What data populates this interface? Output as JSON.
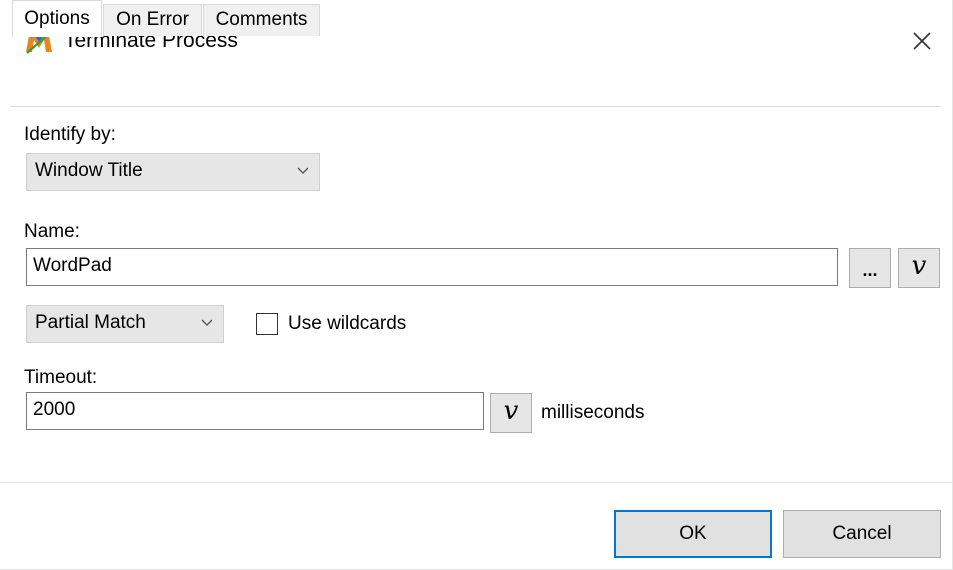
{
  "window": {
    "title": "Terminate Process",
    "app_icon": "macro-m-icon",
    "close_icon": "close-x-icon"
  },
  "tabs": [
    {
      "label": "Options",
      "active": true
    },
    {
      "label": "On Error",
      "active": false
    },
    {
      "label": "Comments",
      "active": false
    }
  ],
  "options": {
    "identify_by": {
      "label": "Identify by:",
      "selected": "Window Title"
    },
    "name": {
      "label": "Name:",
      "value": "WordPad",
      "browse_label": "...",
      "variable_label": "v"
    },
    "match": {
      "selected": "Partial Match"
    },
    "wildcards": {
      "label": "Use wildcards",
      "checked": false
    },
    "timeout": {
      "label": "Timeout:",
      "value": "2000",
      "variable_label": "v",
      "unit": "milliseconds"
    }
  },
  "buttons": {
    "ok": "OK",
    "cancel": "Cancel"
  },
  "colors": {
    "default_button_border": "#0078d7",
    "combo_background": "#e6e6e6"
  }
}
